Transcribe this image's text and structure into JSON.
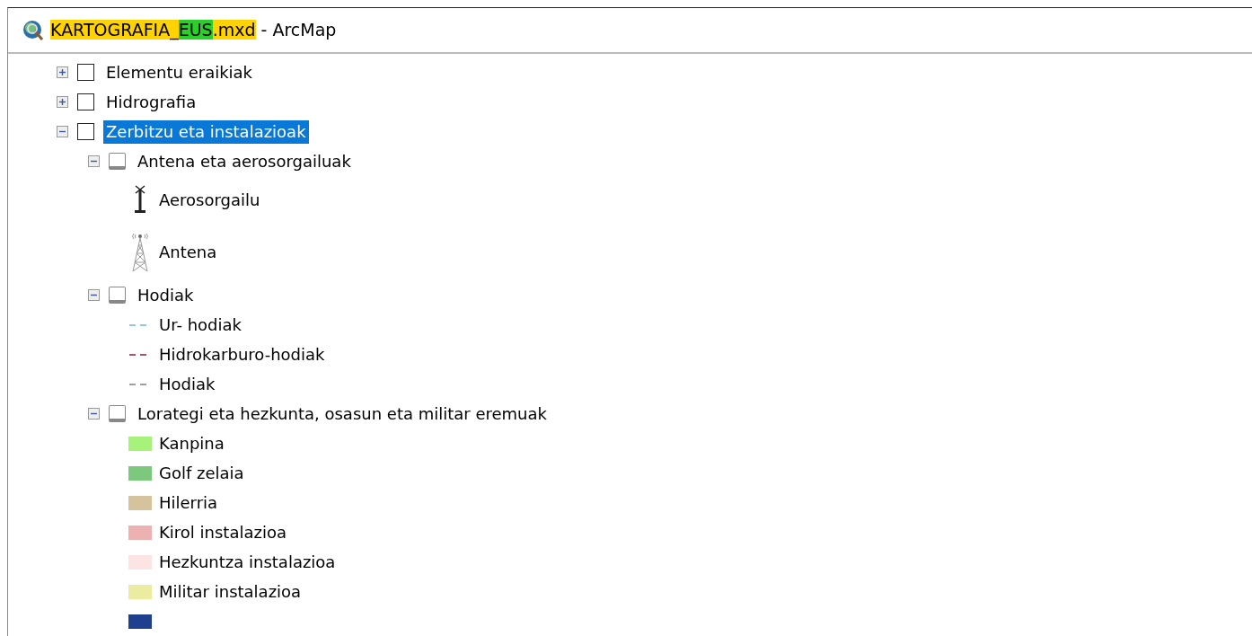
{
  "window": {
    "title_segments": [
      {
        "text": "KARTOGRAFIA_",
        "color": "#ffd200"
      },
      {
        "text": "EUS",
        "color": "#2ad02a"
      },
      {
        "text": ".mxd",
        "color": "#ffd200"
      },
      {
        "text": " - ArcMap"
      }
    ]
  },
  "layers": [
    {
      "name": "Elementu eraikiak",
      "expanded": false,
      "checked": false,
      "selected": false,
      "disabled": false
    },
    {
      "name": "Hidrografia",
      "expanded": false,
      "checked": false,
      "selected": false,
      "disabled": false
    },
    {
      "name": "Zerbitzu eta instalazioak",
      "expanded": true,
      "checked": false,
      "selected": true,
      "disabled": false,
      "children": [
        {
          "name": "Antena eta aerosorgailuak",
          "expanded": true,
          "checked": false,
          "selected": false,
          "disabled": true,
          "legend": [
            {
              "label": "Aerosorgailu",
              "kind": "wind-turbine"
            },
            {
              "label": "Antena",
              "kind": "antenna-tower"
            }
          ]
        },
        {
          "name": "Hodiak",
          "expanded": true,
          "checked": false,
          "selected": false,
          "disabled": true,
          "legend": [
            {
              "label": "Ur- hodiak",
              "kind": "dashed-line",
              "color": "#9cc3e6"
            },
            {
              "label": "Hidrokarburo-hodiak",
              "kind": "dashed-line",
              "color": "#a05a6a"
            },
            {
              "label": "Hodiak",
              "kind": "dashed-line",
              "color": "#a0a0a0"
            }
          ]
        },
        {
          "name": "Lorategi eta hezkunta, osasun eta militar eremuak",
          "expanded": true,
          "checked": false,
          "selected": false,
          "disabled": true,
          "legend": [
            {
              "label": "Kanpina",
              "kind": "fill",
              "color": "#a6f27a"
            },
            {
              "label": "Golf zelaia",
              "kind": "fill",
              "color": "#7cc87c"
            },
            {
              "label": "Hilerria",
              "kind": "fill",
              "color": "#d6c39e"
            },
            {
              "label": "Kirol instalazioa",
              "kind": "fill",
              "color": "#eeb1b1"
            },
            {
              "label": "Hezkuntza instalazioa",
              "kind": "fill",
              "color": "#fde4e4"
            },
            {
              "label": "Militar instalazioa",
              "kind": "fill",
              "color": "#ebeca0"
            },
            {
              "kind": "fill",
              "color": "#1f3f8f"
            }
          ]
        }
      ]
    }
  ]
}
